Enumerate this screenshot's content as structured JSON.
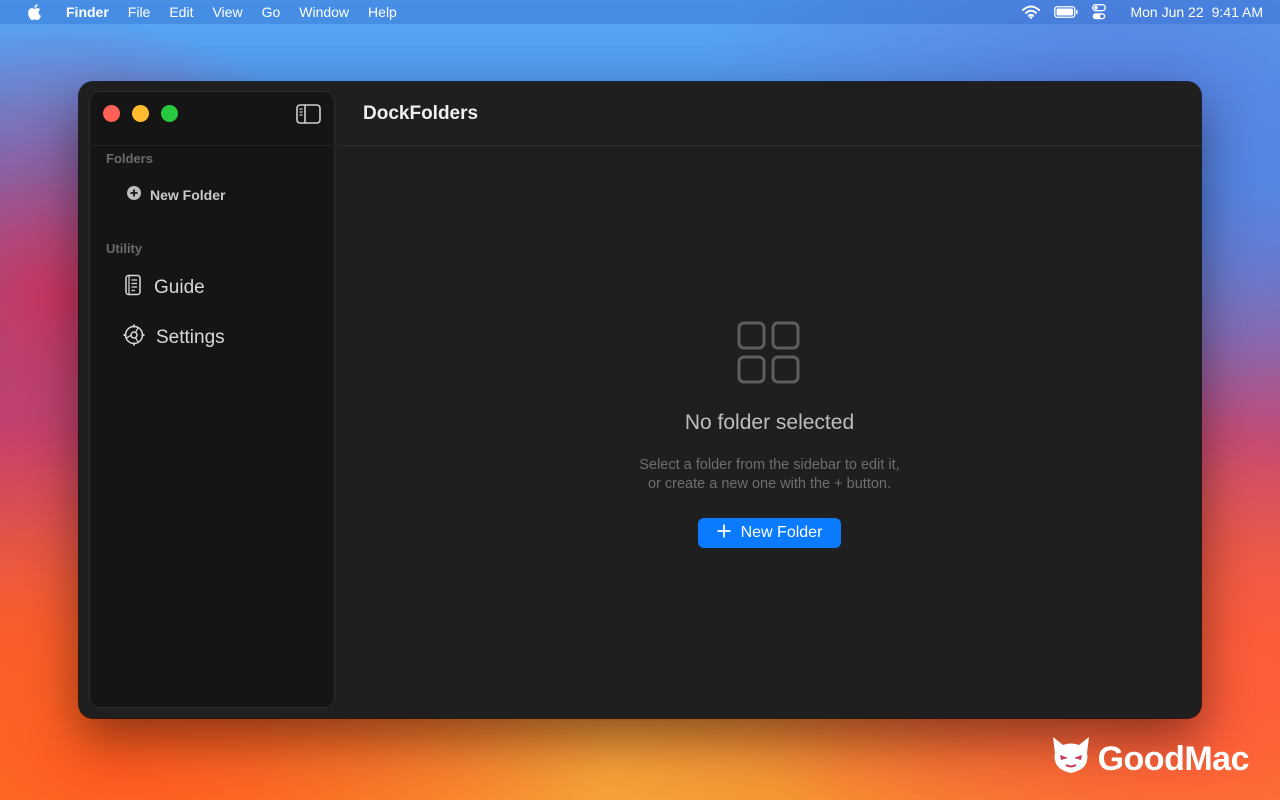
{
  "menubar": {
    "app_name": "Finder",
    "items": [
      "File",
      "Edit",
      "View",
      "Go",
      "Window",
      "Help"
    ],
    "date": "Mon Jun 22",
    "time": "9:41 AM",
    "icons": [
      "apple-icon",
      "wifi-icon",
      "battery-icon",
      "control-center-icon"
    ]
  },
  "window": {
    "title": "DockFolders",
    "sidebar": {
      "folders_section": "Folders",
      "new_folder_label": "New Folder",
      "utility_section": "Utility",
      "items": [
        {
          "label": "Guide",
          "icon": "document-icon"
        },
        {
          "label": "Settings",
          "icon": "gear-icon"
        }
      ]
    },
    "empty_state": {
      "icon": "grid-icon",
      "title": "No folder selected",
      "description_line1": "Select a folder from the sidebar to edit it,",
      "description_line2": "or create a new one with the + button.",
      "button_label": "New Folder"
    }
  },
  "watermark": {
    "text": "GoodMac"
  },
  "colors": {
    "accent": "#0a7bff",
    "window_bg": "#1f1f1f",
    "sidebar_bg": "#151515",
    "close": "#fe5f57",
    "minimize": "#febc2e",
    "zoom": "#28c840"
  }
}
